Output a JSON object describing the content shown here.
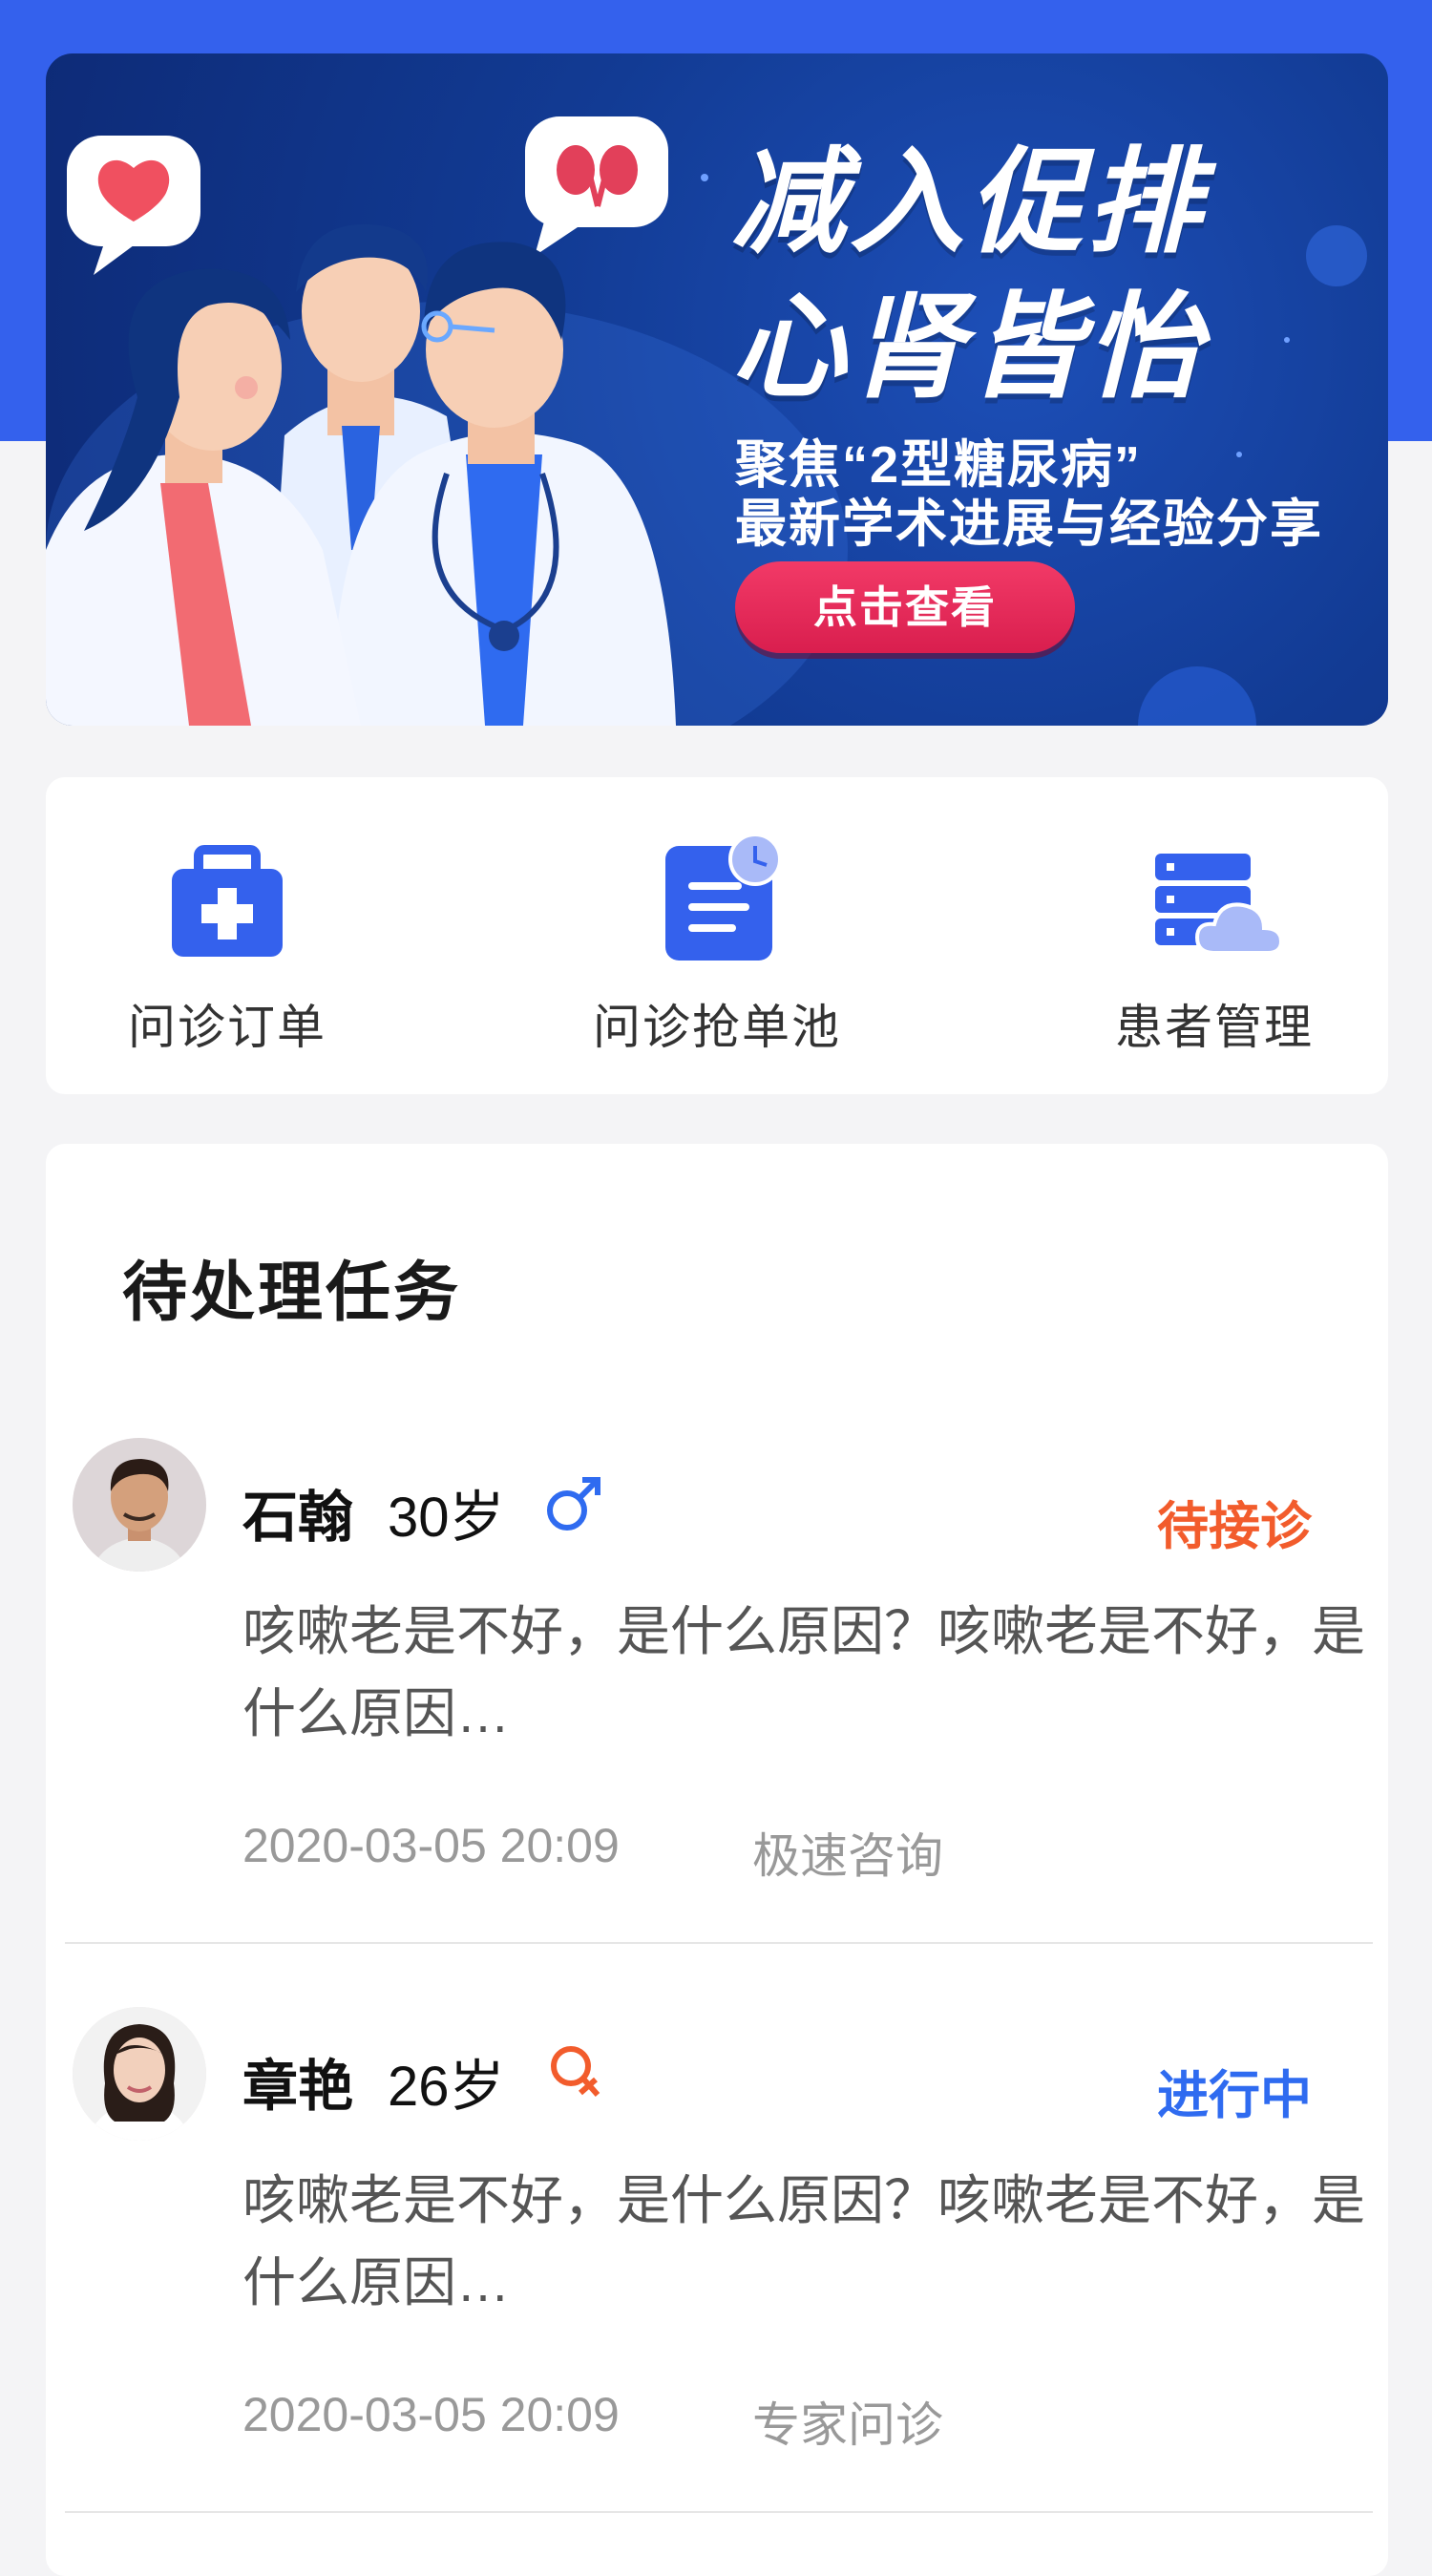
{
  "banner": {
    "title_line1": "减入促排",
    "title_line2": "心肾皆怡",
    "sub_line1": "聚焦“2型糖尿病”",
    "sub_line2": "最新学术进展与经验分享",
    "button_label": "点击查看"
  },
  "menu": {
    "items": [
      {
        "label": "问诊订单",
        "icon": "medical-kit-icon"
      },
      {
        "label": "问诊抢单池",
        "icon": "clipboard-clock-icon"
      },
      {
        "label": "患者管理",
        "icon": "server-cloud-icon"
      }
    ]
  },
  "tasks": {
    "title": "待处理任务",
    "items": [
      {
        "name": "石翰",
        "age": "30岁",
        "gender": "male",
        "status": "待接诊",
        "status_color": "#f25c2c",
        "desc": "咳嗽老是不好，是什么原因？咳嗽老是不好，是什么原因…",
        "time": "2020-03-05 20:09",
        "type": "极速咨询"
      },
      {
        "name": "章艳",
        "age": "26岁",
        "gender": "female",
        "status": "进行中",
        "status_color": "#2f6bf0",
        "desc": "咳嗽老是不好，是什么原因？咳嗽老是不好，是什么原因…",
        "time": "2020-03-05 20:09",
        "type": "专家问诊"
      }
    ]
  },
  "colors": {
    "brand_blue": "#3461ed",
    "male": "#2f6bf0",
    "female": "#f25c2c"
  }
}
